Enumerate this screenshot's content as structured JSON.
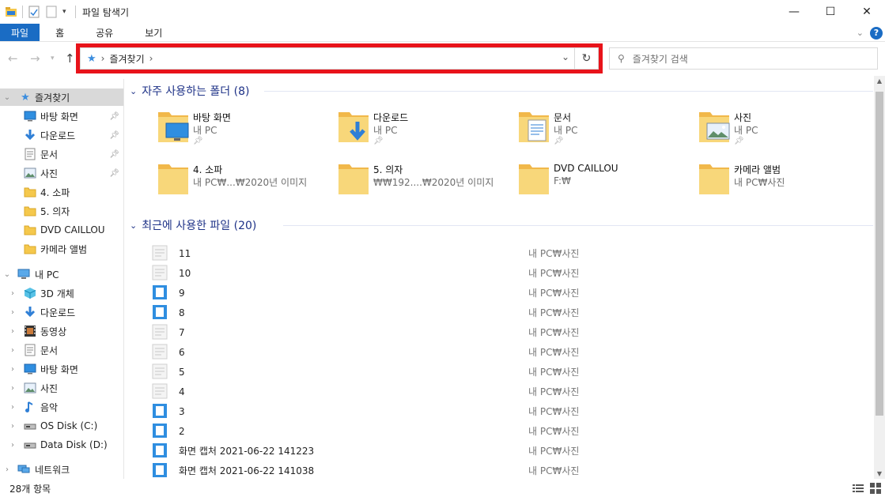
{
  "window": {
    "title": "파일 탐색기",
    "minimize": "—",
    "maximize": "☐",
    "close": "✕"
  },
  "ribbon": {
    "tabs": [
      "파일",
      "홈",
      "공유",
      "보기"
    ]
  },
  "address": {
    "crumb": "즐겨찾기",
    "icon": "star-icon"
  },
  "search": {
    "placeholder": "즐겨찾기 검색"
  },
  "navpane": {
    "quick_access": "즐겨찾기",
    "pinned": [
      {
        "label": "바탕 화면",
        "icon": "desktop-icon",
        "pinned": true
      },
      {
        "label": "다운로드",
        "icon": "download-icon",
        "pinned": true
      },
      {
        "label": "문서",
        "icon": "document-icon",
        "pinned": true
      },
      {
        "label": "사진",
        "icon": "pictures-icon",
        "pinned": true
      },
      {
        "label": "4. 소파",
        "icon": "folder-icon",
        "pinned": false
      },
      {
        "label": "5. 의자",
        "icon": "folder-icon",
        "pinned": false
      },
      {
        "label": "DVD CAILLOU",
        "icon": "folder-icon",
        "pinned": false
      },
      {
        "label": "카메라 앨범",
        "icon": "folder-icon",
        "pinned": false
      }
    ],
    "this_pc": "내 PC",
    "pc_items": [
      {
        "label": "3D 개체",
        "icon": "3d-objects-icon"
      },
      {
        "label": "다운로드",
        "icon": "download-icon"
      },
      {
        "label": "동영상",
        "icon": "video-icon"
      },
      {
        "label": "문서",
        "icon": "document-icon"
      },
      {
        "label": "바탕 화면",
        "icon": "desktop-icon"
      },
      {
        "label": "사진",
        "icon": "pictures-icon"
      },
      {
        "label": "음악",
        "icon": "music-icon"
      },
      {
        "label": "OS Disk (C:)",
        "icon": "drive-icon"
      },
      {
        "label": "Data Disk (D:)",
        "icon": "drive-icon"
      }
    ],
    "network": "네트워크"
  },
  "frequent": {
    "heading": "자주 사용하는 폴더 (8)",
    "folders": [
      {
        "name": "바탕 화면",
        "sub": "내 PC",
        "pinned": true,
        "icon": "desktop-folder-icon"
      },
      {
        "name": "다운로드",
        "sub": "내 PC",
        "pinned": true,
        "icon": "download-folder-icon"
      },
      {
        "name": "문서",
        "sub": "내 PC",
        "pinned": true,
        "icon": "document-folder-icon"
      },
      {
        "name": "사진",
        "sub": "내 PC",
        "pinned": true,
        "icon": "pictures-folder-icon"
      },
      {
        "name": "4. 소파",
        "sub": "내 PC₩...₩2020년 이미지",
        "pinned": false,
        "icon": "folder-icon"
      },
      {
        "name": "5. 의자",
        "sub": "₩₩192....₩2020년 이미지",
        "pinned": false,
        "icon": "folder-icon"
      },
      {
        "name": "DVD CAILLOU",
        "sub": "F:₩",
        "pinned": false,
        "icon": "folder-icon"
      },
      {
        "name": "카메라 앨범",
        "sub": "내 PC₩사진",
        "pinned": false,
        "icon": "folder-icon"
      }
    ]
  },
  "recent": {
    "heading": "최근에 사용한 파일 (20)",
    "files": [
      {
        "name": "11",
        "location": "내 PC₩사진",
        "icon": "image-file-icon"
      },
      {
        "name": "10",
        "location": "내 PC₩사진",
        "icon": "image-file-icon"
      },
      {
        "name": "9",
        "location": "내 PC₩사진",
        "icon": "image-file-icon"
      },
      {
        "name": "8",
        "location": "내 PC₩사진",
        "icon": "image-file-icon"
      },
      {
        "name": "7",
        "location": "내 PC₩사진",
        "icon": "image-file-icon"
      },
      {
        "name": "6",
        "location": "내 PC₩사진",
        "icon": "image-file-icon"
      },
      {
        "name": "5",
        "location": "내 PC₩사진",
        "icon": "image-file-icon"
      },
      {
        "name": "4",
        "location": "내 PC₩사진",
        "icon": "image-file-icon"
      },
      {
        "name": "3",
        "location": "내 PC₩사진",
        "icon": "image-file-icon"
      },
      {
        "name": "2",
        "location": "내 PC₩사진",
        "icon": "image-file-icon"
      },
      {
        "name": "화면 캡처 2021-06-22 141223",
        "location": "내 PC₩사진",
        "icon": "image-file-icon"
      },
      {
        "name": "화면 캡처 2021-06-22 141038",
        "location": "내 PC₩사진",
        "icon": "image-file-icon"
      }
    ]
  },
  "status": {
    "count": "28개 항목"
  },
  "colors": {
    "accent": "#1a6cc4",
    "highlight_border": "#e8131a",
    "group_heading": "#1e3287",
    "folder": "#f5c84c"
  }
}
